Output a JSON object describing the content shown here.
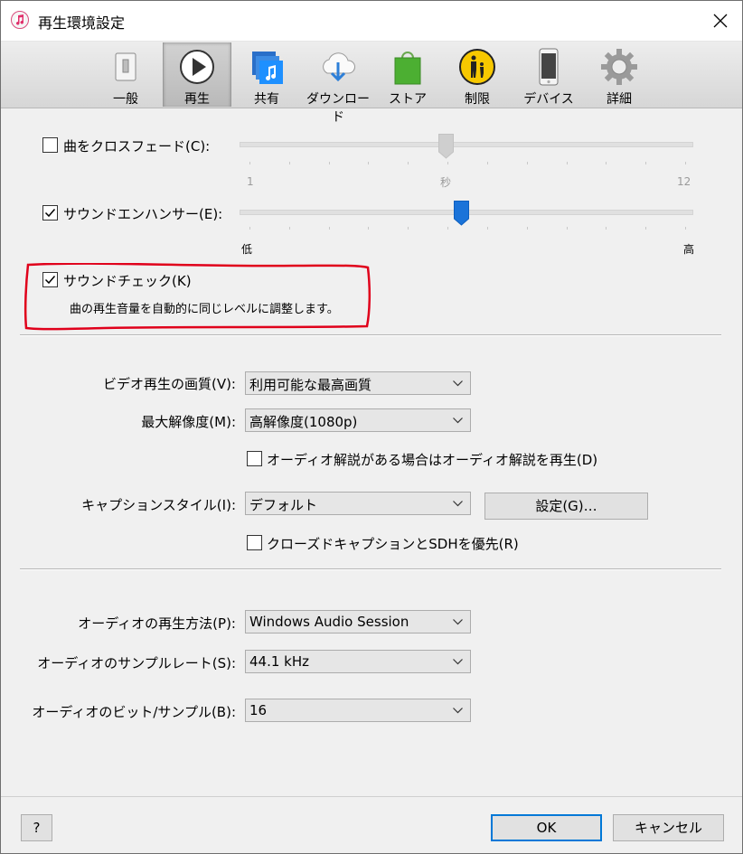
{
  "window": {
    "title": "再生環境設定"
  },
  "toolbar": {
    "tabs": [
      {
        "label": "一般"
      },
      {
        "label": "再生"
      },
      {
        "label": "共有"
      },
      {
        "label": "ダウンロード"
      },
      {
        "label": "ストア"
      },
      {
        "label": "制限"
      },
      {
        "label": "デバイス"
      },
      {
        "label": "詳細"
      }
    ],
    "active_tab": "再生"
  },
  "crossfade": {
    "label": "曲をクロスフェード(C):",
    "checked": false,
    "scale_min": "1",
    "scale_unit": "秒",
    "scale_max": "12"
  },
  "enhancer": {
    "label": "サウンドエンハンサー(E):",
    "checked": true,
    "scale_low": "低",
    "scale_high": "高"
  },
  "sound_check": {
    "label": "サウンドチェック(K)",
    "checked": true,
    "description": "曲の再生音量を自動的に同じレベルに調整します。"
  },
  "video": {
    "quality_label": "ビデオ再生の画質(V):",
    "quality_value": "利用可能な最高画質",
    "max_res_label": "最大解像度(M):",
    "max_res_value": "高解像度(1080p)",
    "audio_desc_label": "オーディオ解説がある場合はオーディオ解説を再生(D)",
    "audio_desc_checked": false,
    "caption_label": "キャプションスタイル(I):",
    "caption_value": "デフォルト",
    "caption_settings_button": "設定(G)…",
    "cc_label": "クローズドキャプションとSDHを優先(R)",
    "cc_checked": false
  },
  "audio": {
    "method_label": "オーディオの再生方法(P):",
    "method_value": "Windows Audio Session",
    "rate_label": "オーディオのサンプルレート(S):",
    "rate_value": "44.1 kHz",
    "bits_label": "オーディオのビット/サンプル(B):",
    "bits_value": "16"
  },
  "footer": {
    "help_label": "?",
    "ok_label": "OK",
    "cancel_label": "キャンセル"
  },
  "colors": {
    "accent": "#0078d7",
    "annotation": "#e0001b",
    "enhancer_thumb": "#1a73d9"
  }
}
